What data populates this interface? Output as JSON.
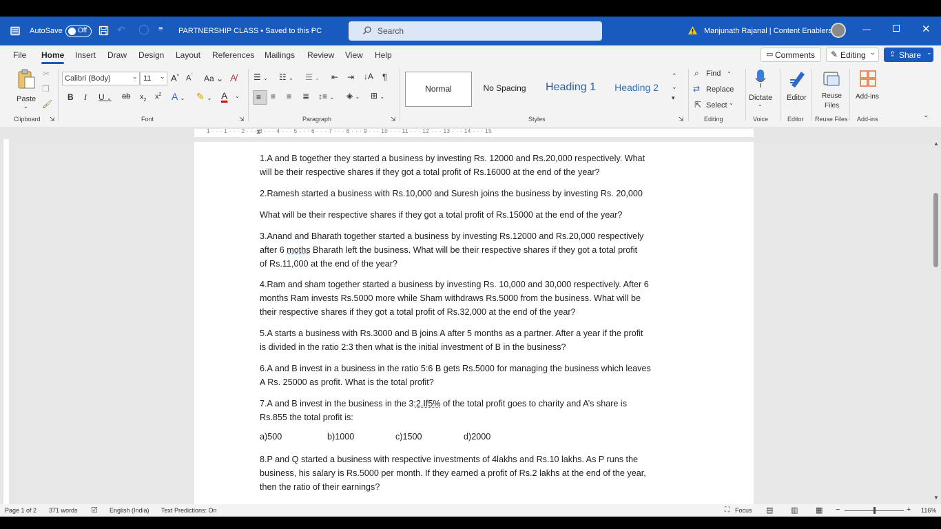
{
  "titlebar": {
    "autosave_label": "AutoSave",
    "autosave_state": "Off",
    "doc_title": "PARTNERSHIP CLASS • Saved to this PC",
    "search_placeholder": "Search",
    "user_name": "Manjunath Rajanal | Content Enablers",
    "accent_color": "#185abd"
  },
  "menubar": {
    "tabs": [
      "File",
      "Home",
      "Insert",
      "Draw",
      "Design",
      "Layout",
      "References",
      "Mailings",
      "Review",
      "View",
      "Help"
    ],
    "active_tab": "Home",
    "comments_label": "Comments",
    "editing_label": "Editing",
    "share_label": "Share"
  },
  "ribbon": {
    "paste_label": "Paste",
    "font_name": "Calibri (Body)",
    "font_size": "11",
    "styles": [
      "Normal",
      "No Spacing",
      "Heading 1",
      "Heading 2"
    ],
    "find_label": "Find",
    "replace_label": "Replace",
    "select_label": "Select",
    "dictate_label": "Dictate",
    "editor_label": "Editor",
    "reuse_label": "Reuse",
    "files_label": "Files",
    "addins_label": "Add-ins",
    "groups": {
      "clipboard": "Clipboard",
      "font": "Font",
      "paragraph": "Paragraph",
      "styles": "Styles",
      "editing": "Editing",
      "voice": "Voice",
      "editor": "Editor",
      "reuse_files": "Reuse Files",
      "addins": "Add-ins"
    }
  },
  "ruler_text": "1 · · · 1 · · · 2 · · · 3 · · · 4 · · · 5 · · · 6 · · · 7 · · · 8 · · · 9 · · · 10 · · · 11 · · · 12 · · · 13 · · · 14 · · · 15",
  "document": {
    "q1_line1": "1.A and B together they started a business by investing Rs. 12000 and Rs.20,000 respectively. What",
    "q1_line2": "will be their respective shares if they got a total profit of Rs.16000 at the end of the year?",
    "q2_line1": "2.Ramesh started a business with Rs.10,000 and Suresh joins the business by investing Rs. 20,000",
    "q2_line2": "What will be their respective shares if they got a total profit of Rs.15000 at the end of the year?",
    "q3_line1": "3.Anand and Bharath together started a business by investing Rs.12000 and Rs.20,000 respectively",
    "q3_line2_pre": "after 6 ",
    "q3_line2_misspelt": "moths",
    "q3_line2_post": " Bharath left the business. What will be their respective shares if they got a total profit",
    "q3_line3": "of Rs.11,000 at the end of the year?",
    "q4_line1": "4.Ram and sham together started a business by investing Rs. 10,000 and 30,000 respectively. After 6",
    "q4_line2": "months Ram invests Rs.5000 more while Sham withdraws Rs.5000 from the business. What will be",
    "q4_line3": "their respective shares if they got a total profit of Rs.32,000 at the end of the year?",
    "q5_line1": "5.A starts a business with Rs.3000 and B joins A after 5 months as a partner. After a year if the profit",
    "q5_line2": "is divided in the ratio 2:3 then what is the initial investment of B in the business?",
    "q6_line1": "6.A and B invest in a business in the ratio 5:6 B gets Rs.5000 for managing the business which leaves",
    "q6_line2": "A Rs. 25000 as profit. What is the total profit?",
    "q7_line1_pre": "7.A and B invest in the business in the 3:",
    "q7_line1_ul": "2.If5%",
    "q7_line1_post": " of the total profit goes to charity and A’s share is",
    "q7_line2": "Rs.855 the total profit is:",
    "q7_options": [
      "a)500",
      "b)1000",
      "c)1500",
      "d)2000"
    ],
    "q8_line1": "8.P and Q started a business with respective investments of 4lakhs and Rs.10 lakhs. As P runs the",
    "q8_line2": "business, his salary is Rs.5000 per month. If they earned a profit of Rs.2 lakhs at the end of the year,",
    "q8_line3": "then the ratio of their earnings?"
  },
  "statusbar": {
    "page": "Page 1 of 2",
    "words": "371 words",
    "language": "English (India)",
    "predictions": "Text Predictions: On",
    "focus": "Focus",
    "zoom": "116%"
  }
}
